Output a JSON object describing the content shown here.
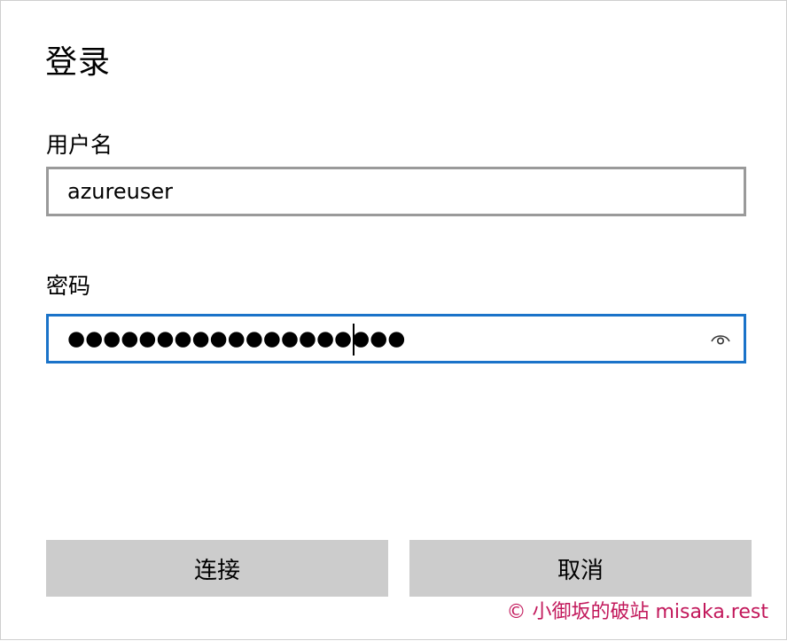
{
  "dialog": {
    "title": "登录"
  },
  "username": {
    "label": "用户名",
    "value": "azureuser"
  },
  "password": {
    "label": "密码",
    "masked_value": "●●●●●●●●●●●●●●●●●●●",
    "reveal_icon": "eye-icon"
  },
  "buttons": {
    "connect_label": "连接",
    "cancel_label": "取消"
  },
  "watermark": {
    "text": "© 小御坂的破站 misaka.rest"
  },
  "colors": {
    "focus_border": "#1a73c9",
    "field_border": "#9a9a9a",
    "button_bg": "#cccccc",
    "watermark": "#c2185b"
  }
}
